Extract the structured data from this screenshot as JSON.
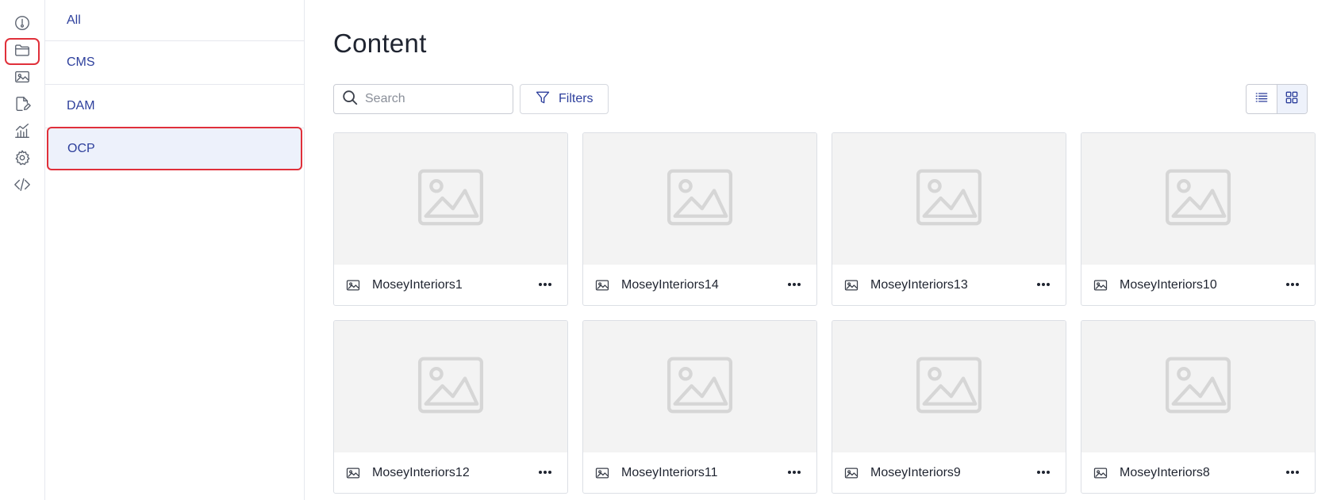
{
  "rail": {
    "items": [
      {
        "icon": "info-dial-icon",
        "highlighted": false
      },
      {
        "icon": "folder-icon",
        "highlighted": true
      },
      {
        "icon": "image-icon",
        "highlighted": false
      },
      {
        "icon": "edit-document-icon",
        "highlighted": false
      },
      {
        "icon": "analytics-chart-icon",
        "highlighted": false
      },
      {
        "icon": "gear-icon",
        "highlighted": false
      },
      {
        "icon": "code-icon",
        "highlighted": false
      }
    ]
  },
  "categories": {
    "items": [
      {
        "label": "All"
      },
      {
        "label": "CMS"
      },
      {
        "label": "DAM"
      },
      {
        "label": "OCP"
      }
    ],
    "selected": "OCP"
  },
  "main": {
    "title": "Content",
    "search": {
      "placeholder": "Search",
      "value": ""
    },
    "filters_label": "Filters",
    "view_mode": "grid"
  },
  "assets": [
    {
      "name": "MoseyInteriors1"
    },
    {
      "name": "MoseyInteriors14"
    },
    {
      "name": "MoseyInteriors13"
    },
    {
      "name": "MoseyInteriors10"
    },
    {
      "name": "MoseyInteriors12"
    },
    {
      "name": "MoseyInteriors11"
    },
    {
      "name": "MoseyInteriors9"
    },
    {
      "name": "MoseyInteriors8"
    }
  ],
  "colors": {
    "accent": "#2d3f9c",
    "highlight": "#e0303a",
    "selected_bg": "#edf1fb",
    "thumb_bg": "#f3f3f3"
  }
}
